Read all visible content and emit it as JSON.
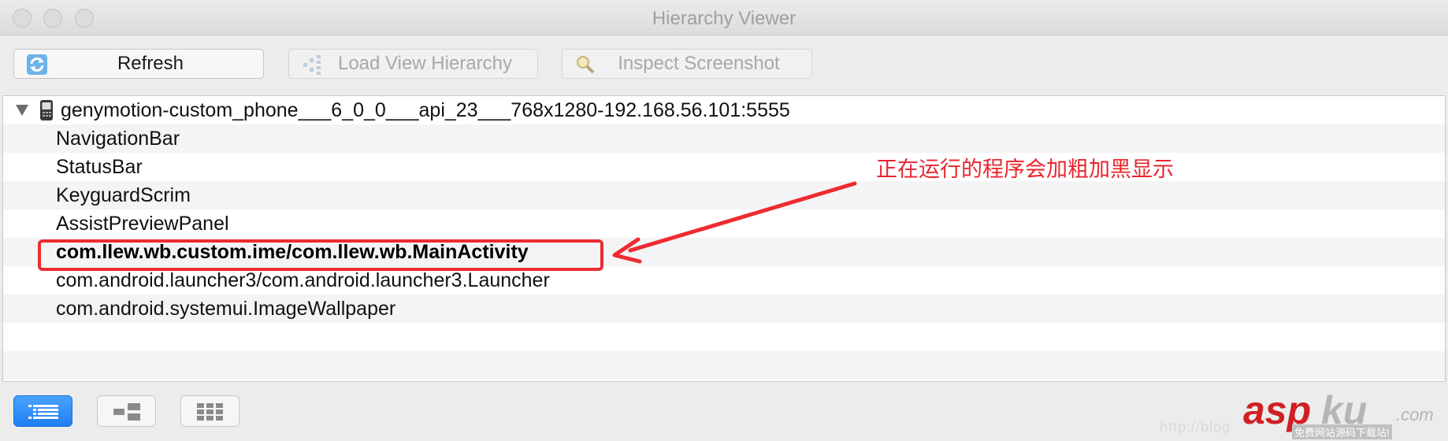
{
  "window": {
    "title": "Hierarchy Viewer"
  },
  "toolbar": {
    "refresh_label": "Refresh",
    "load_label": "Load View Hierarchy",
    "inspect_label": "Inspect Screenshot"
  },
  "device": {
    "name": "genymotion-custom_phone___6_0_0___api_23___768x1280-192.168.56.101:5555"
  },
  "windows_list": [
    {
      "name": "NavigationBar",
      "active": false
    },
    {
      "name": "StatusBar",
      "active": false
    },
    {
      "name": "KeyguardScrim",
      "active": false
    },
    {
      "name": "AssistPreviewPanel",
      "active": false
    },
    {
      "name": "com.llew.wb.custom.ime/com.llew.wb.MainActivity",
      "active": true
    },
    {
      "name": "com.android.launcher3/com.android.launcher3.Launcher",
      "active": false
    },
    {
      "name": "com.android.systemui.ImageWallpaper",
      "active": false
    }
  ],
  "annotation": {
    "text": "正在运行的程序会加粗加黑显示",
    "color": "#e8252e"
  },
  "bottom_bar": {
    "views": [
      {
        "icon": "list-view-icon",
        "selected": true
      },
      {
        "icon": "tree-view-icon",
        "selected": false
      },
      {
        "icon": "grid-view-icon",
        "selected": false
      }
    ]
  },
  "watermark": {
    "url": "http://blog",
    "brand_main": "asp",
    "brand_ku": "ku",
    "brand_com": ".com",
    "tagline": "免费网站源码下载站!"
  },
  "colors": {
    "accent": "#1f7ff2",
    "annotation_red": "#ee2b32"
  }
}
